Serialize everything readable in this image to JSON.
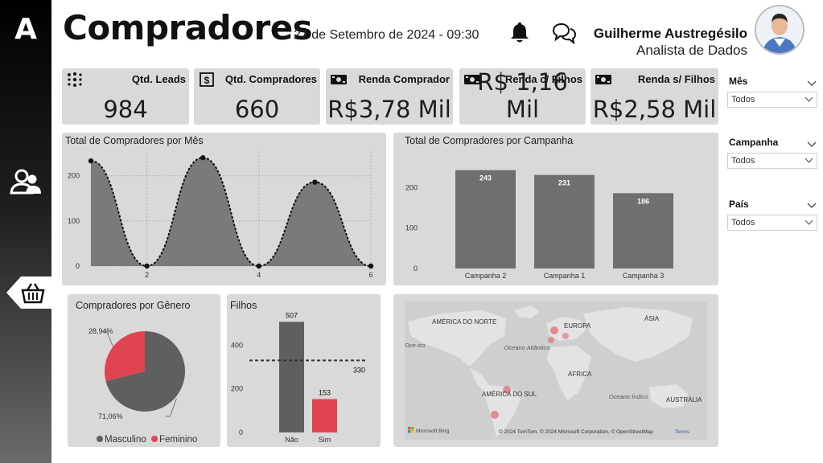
{
  "sidebar": {
    "logo": "A",
    "nav_items": [
      {
        "icon": "users-icon"
      },
      {
        "icon": "basket-icon"
      }
    ]
  },
  "header": {
    "title": "Compradores",
    "datetime": "27 de Setembro de 2024 - 09:30",
    "user_name": "Guilherme Austregésilo",
    "user_role": "Analista de Dados"
  },
  "kpis": [
    {
      "label": "Qtd. Leads",
      "value": "984",
      "icon": "dots-grid-icon"
    },
    {
      "label": "Qtd. Compradores",
      "value": "660",
      "icon": "dollar-tag-icon"
    },
    {
      "label": "Renda Comprador",
      "value": "R$3,78 Mil",
      "icon": "money-icon"
    },
    {
      "label": "Renda c/ Filhos",
      "value": "R$ 1,16 Mil",
      "icon": "money-icon"
    },
    {
      "label": "Renda s/ Filhos",
      "value": "R$2,58 Mil",
      "icon": "money-icon"
    }
  ],
  "filters": [
    {
      "label": "Mês",
      "value": "Todos"
    },
    {
      "label": "Campanha",
      "value": "Todos"
    },
    {
      "label": "País",
      "value": "Todos"
    }
  ],
  "chart_data": [
    {
      "type": "area",
      "title": "Total de Compradores por Mês",
      "x": [
        1,
        2,
        3,
        4,
        5,
        6
      ],
      "values": [
        233,
        0,
        240,
        0,
        186,
        0
      ],
      "xticks": [
        "2",
        "4",
        "6"
      ],
      "yticks": [
        "0",
        "100",
        "200"
      ],
      "ylim": [
        0,
        260
      ],
      "grid": true
    },
    {
      "type": "bar",
      "title": "Total de Compradores por Campanha",
      "categories": [
        "Campanha 2",
        "Campanha 1",
        "Campanha 3"
      ],
      "values": [
        243,
        231,
        186
      ],
      "yticks": [
        "0",
        "100",
        "200"
      ],
      "ylim": [
        0,
        280
      ]
    },
    {
      "type": "pie",
      "title": "Compradores por Gênero",
      "labels": [
        "Masculino",
        "Feminino"
      ],
      "values": [
        71.06,
        28.94
      ],
      "value_labels": [
        "71,06%",
        "28,94%"
      ],
      "colors": [
        "#5f5f5f",
        "#e0434f"
      ],
      "legend": "bottom"
    },
    {
      "type": "bar",
      "title": "Filhos",
      "categories": [
        "Não",
        "Sim"
      ],
      "values": [
        507,
        153
      ],
      "colors": [
        "#5f5f5f",
        "#e0434f"
      ],
      "yticks": [
        "0",
        "200",
        "400"
      ],
      "ylim": [
        0,
        560
      ],
      "average_line": 330,
      "average_label": "330"
    }
  ],
  "map": {
    "labels": [
      "AMÉRICA DO NORTE",
      "EUROPA",
      "ÁSIA",
      "Oceano Atlântico",
      "ÁFRICA",
      "AMÉRICA DO SUL",
      "Oceano Índico",
      "AUSTRÁLIA",
      "Oce ico"
    ],
    "attribution": "© 2024 TomTom, © 2024 Microsoft Corporation, © OpenStreetMap",
    "terms": "Terms",
    "brand": "Microsoft Bing"
  },
  "colors": {
    "accent_red": "#e0434f",
    "dark_gray": "#5f5f5f",
    "panel_bg": "#d9d9d9"
  }
}
